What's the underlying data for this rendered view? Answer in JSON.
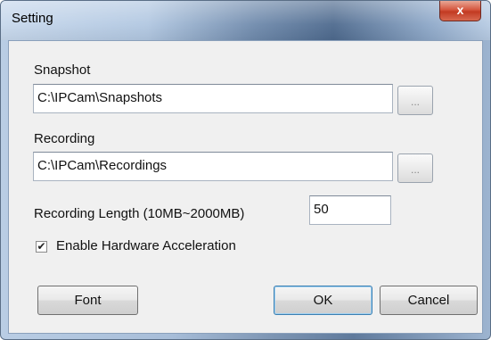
{
  "window": {
    "title": "Setting",
    "close_glyph": "x"
  },
  "snapshot": {
    "label": "Snapshot",
    "path": "C:\\IPCam\\Snapshots",
    "browse_label": "..."
  },
  "recording": {
    "label": "Recording",
    "path": "C:\\IPCam\\Recordings",
    "browse_label": "..."
  },
  "recording_length": {
    "label": "Recording Length (10MB~2000MB)",
    "value": "50"
  },
  "hardware_acceleration": {
    "label": "Enable Hardware Acceleration",
    "checked": true,
    "check_glyph": "✔"
  },
  "buttons": {
    "font": "Font",
    "ok": "OK",
    "cancel": "Cancel"
  }
}
